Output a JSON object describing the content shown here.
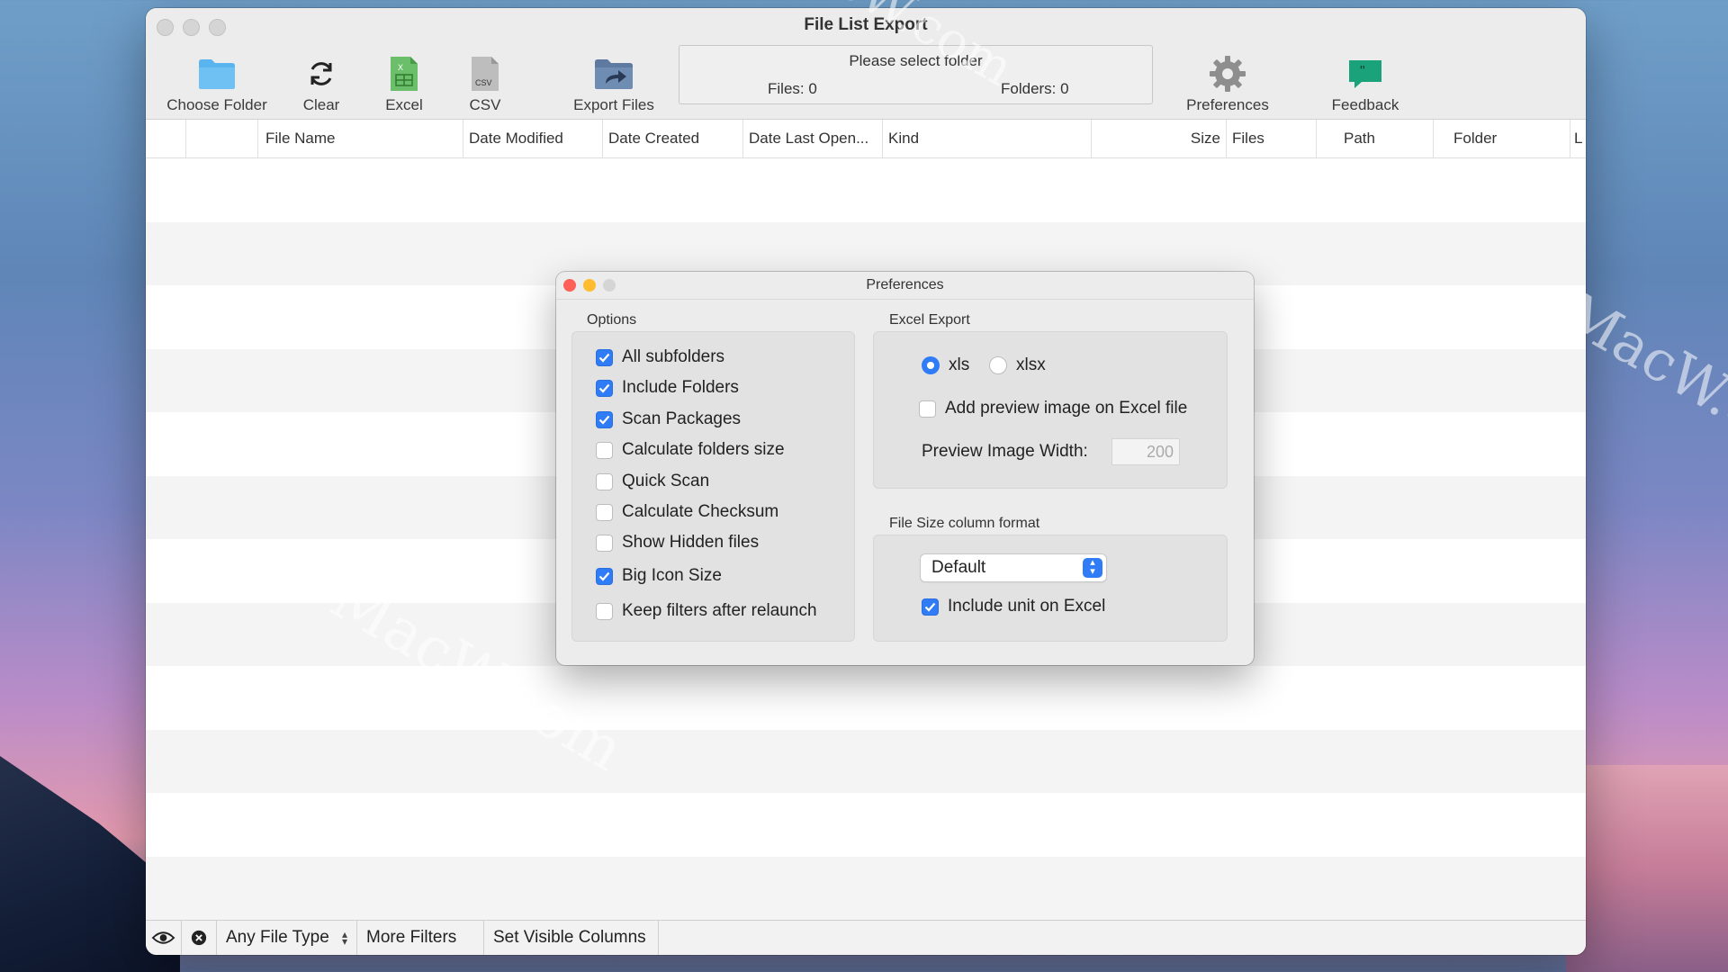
{
  "window": {
    "title": "File List Export"
  },
  "toolbar": {
    "choose_folder": "Choose Folder",
    "clear": "Clear",
    "excel": "Excel",
    "csv": "CSV",
    "csv_icon_text": "CSV",
    "excel_icon_text": "X",
    "export_files": "Export Files",
    "preferences": "Preferences",
    "feedback": "Feedback"
  },
  "status": {
    "message": "Please select folder",
    "files": "Files: 0",
    "folders": "Folders: 0"
  },
  "columns": [
    "File Name",
    "Date Modified",
    "Date Created",
    "Date Last Open...",
    "Kind",
    "Size",
    "Files",
    "Path",
    "Folder",
    "L"
  ],
  "bottom_bar": {
    "file_type": "Any File Type",
    "more_filters": "More Filters",
    "set_visible_columns": "Set Visible Columns"
  },
  "preferences": {
    "title": "Preferences",
    "options_title": "Options",
    "options": [
      {
        "label": "All subfolders",
        "checked": true
      },
      {
        "label": "Include Folders",
        "checked": true
      },
      {
        "label": "Scan Packages",
        "checked": true
      },
      {
        "label": "Calculate folders size",
        "checked": false
      },
      {
        "label": "Quick Scan",
        "checked": false
      },
      {
        "label": "Calculate Checksum",
        "checked": false
      },
      {
        "label": "Show Hidden files",
        "checked": false
      },
      {
        "label": "Big Icon Size",
        "checked": true
      },
      {
        "label": "Keep filters after relaunch",
        "checked": false
      }
    ],
    "excel_export_title": "Excel Export",
    "format_xls": "xls",
    "format_xlsx": "xlsx",
    "selected_format": "xls",
    "add_preview_label": "Add preview image on Excel file",
    "add_preview_checked": false,
    "preview_width_label": "Preview Image Width:",
    "preview_width_value": "200",
    "file_size_title": "File Size column format",
    "file_size_format": "Default",
    "include_unit_label": "Include unit on Excel",
    "include_unit_checked": true
  },
  "watermark": {
    "text": "MacW.com"
  },
  "colors": {
    "accent": "#2f7cf6",
    "close": "#fe5f57",
    "minimize": "#febc2e",
    "feedback_icon": "#1aa37a",
    "folder_icon": "#5ab4ee"
  }
}
